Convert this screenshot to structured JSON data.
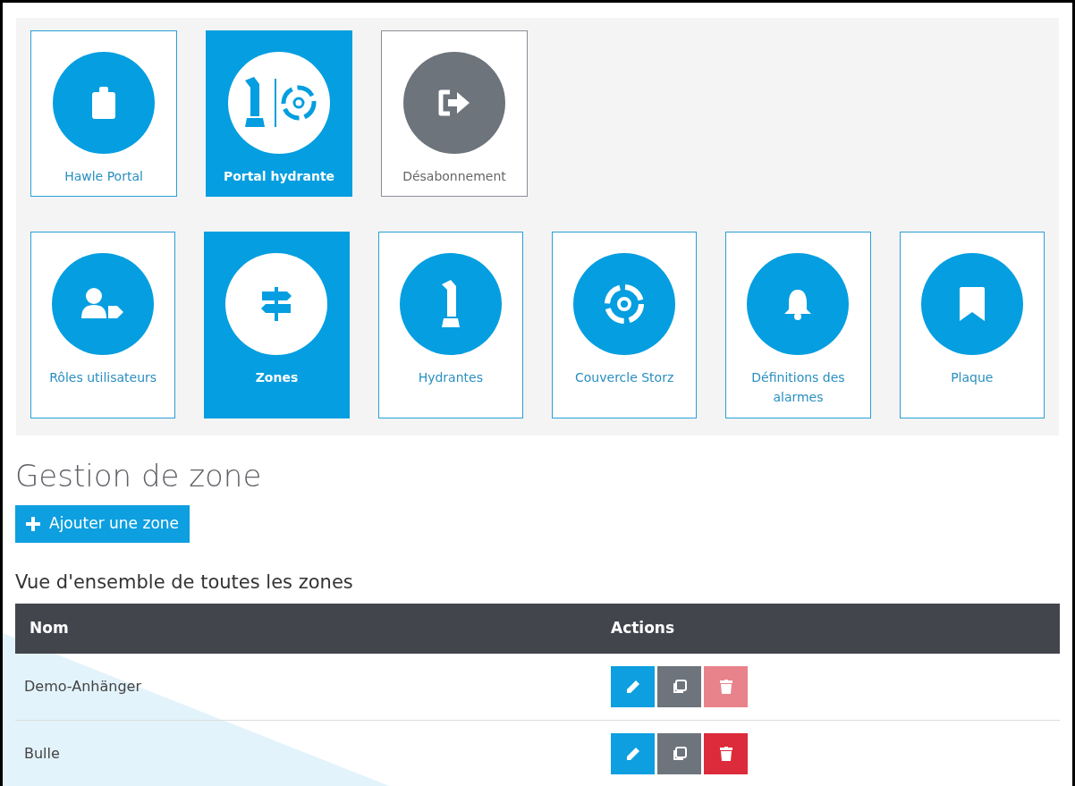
{
  "tile_rows": [
    [
      {
        "label": "Hawle Portal",
        "kind": "app",
        "selected": false
      },
      {
        "label": "Portal hydrante",
        "kind": "app",
        "selected": true
      },
      {
        "label": "Désabonnement",
        "kind": "logout",
        "selected": false
      }
    ],
    [
      {
        "label": "Rôles utilisateurs",
        "kind": "app",
        "selected": false
      },
      {
        "label": "Zones",
        "kind": "app",
        "selected": true
      },
      {
        "label": "Hydrantes",
        "kind": "app",
        "selected": false
      },
      {
        "label": "Couvercle Storz",
        "kind": "app",
        "selected": false
      },
      {
        "label": "Définitions des alarmes",
        "kind": "app",
        "selected": false
      },
      {
        "label": "Plaque",
        "kind": "app",
        "selected": false
      }
    ]
  ],
  "page_title": "Gestion de zone",
  "add_button": "Ajouter une zone",
  "overview_title": "Vue d'ensemble de toutes les zones",
  "table": {
    "columns": [
      "Nom",
      "Actions"
    ],
    "rows": [
      {
        "name": "Demo-Anhänger",
        "delete_disabled": true
      },
      {
        "name": "Bulle",
        "delete_disabled": false
      }
    ]
  }
}
